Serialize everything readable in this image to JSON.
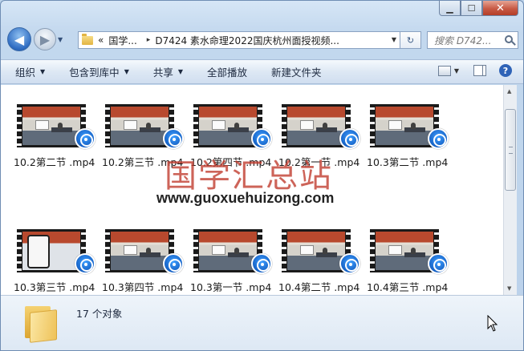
{
  "window": {
    "minimize_glyph": "▁",
    "maximize_glyph": "☐",
    "close_glyph": "✕"
  },
  "address": {
    "overflow": "«",
    "segments": [
      "国学...",
      "D7424 素水命理2022国庆杭州面授视频..."
    ],
    "separator": "▸"
  },
  "search": {
    "placeholder": "搜索 D742..."
  },
  "toolbar": {
    "organize": "组织",
    "include_library": "包含到库中",
    "share": "共享",
    "play_all": "全部播放",
    "new_folder": "新建文件夹"
  },
  "files": [
    {
      "name": "10.2第二节 .mp4",
      "scene": "room"
    },
    {
      "name": "10.2第三节 .mp4",
      "scene": "room"
    },
    {
      "name": "10.2第四节 .mp4",
      "scene": "room"
    },
    {
      "name": "10.2第一节 .mp4",
      "scene": "room"
    },
    {
      "name": "10.3第二节 .mp4",
      "scene": "room"
    },
    {
      "name": "10.3第三节 .mp4",
      "scene": "phone"
    },
    {
      "name": "10.3第四节 .mp4",
      "scene": "room"
    },
    {
      "name": "10.3第一节 .mp4",
      "scene": "room"
    },
    {
      "name": "10.4第二节 .mp4",
      "scene": "room"
    },
    {
      "name": "10.4第三节 .mp4",
      "scene": "room"
    }
  ],
  "watermark": {
    "title": "国学汇总站",
    "url": "www.guoxuehuizong.com"
  },
  "details": {
    "count_text": "17 个对象"
  },
  "colors": {
    "accent": "#2f6cc2",
    "watermark": "#c0392b"
  }
}
